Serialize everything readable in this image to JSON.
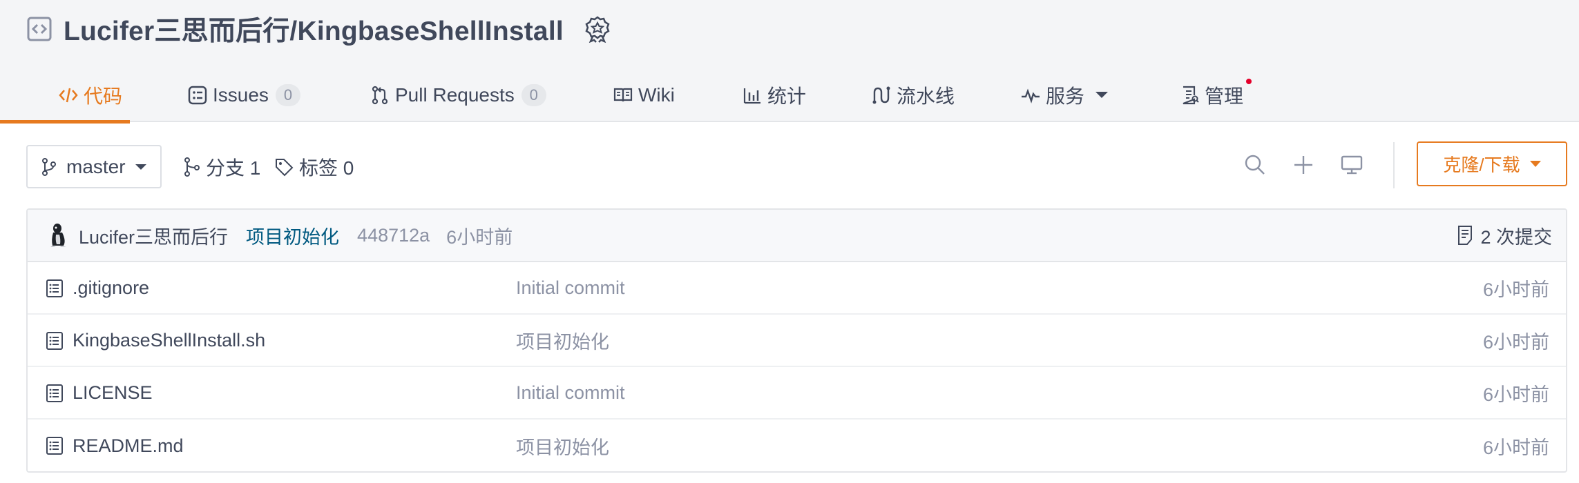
{
  "repo": {
    "title": "Lucifer三思而后行/KingbaseShellInstall",
    "icon": "code-box-icon",
    "badge_icon": "recommend-medal-icon"
  },
  "tabs": [
    {
      "label": "代码",
      "icon": "code-icon",
      "active": true
    },
    {
      "label": "Issues",
      "icon": "issues-icon",
      "count": "0"
    },
    {
      "label": "Pull Requests",
      "icon": "pull-request-icon",
      "count": "0"
    },
    {
      "label": "Wiki",
      "icon": "book-icon"
    },
    {
      "label": "统计",
      "icon": "bar-chart-icon"
    },
    {
      "label": "流水线",
      "icon": "pipeline-icon"
    },
    {
      "label": "服务",
      "icon": "pulse-icon"
    },
    {
      "label": "管理",
      "icon": "manage-icon"
    }
  ],
  "toolbar": {
    "branch": "master",
    "branches_label": "分支 1",
    "tags_label": "标签 0",
    "clone_label": "克隆/下载"
  },
  "commit": {
    "author": "Lucifer三思而后行",
    "message": "项目初始化",
    "sha": "448712a",
    "time": "6小时前",
    "count_label": "2 次提交"
  },
  "files": [
    {
      "name": ".gitignore",
      "commit": "Initial commit",
      "time": "6小时前"
    },
    {
      "name": "KingbaseShellInstall.sh",
      "commit": "项目初始化",
      "time": "6小时前"
    },
    {
      "name": "LICENSE",
      "commit": "Initial commit",
      "time": "6小时前"
    },
    {
      "name": "README.md",
      "commit": "项目初始化",
      "time": "6小时前"
    }
  ],
  "colors": {
    "accent": "#e67a1f",
    "text": "#40485b",
    "muted": "#8c92a4",
    "link": "#005980",
    "notification_dot": "#e4002b"
  }
}
